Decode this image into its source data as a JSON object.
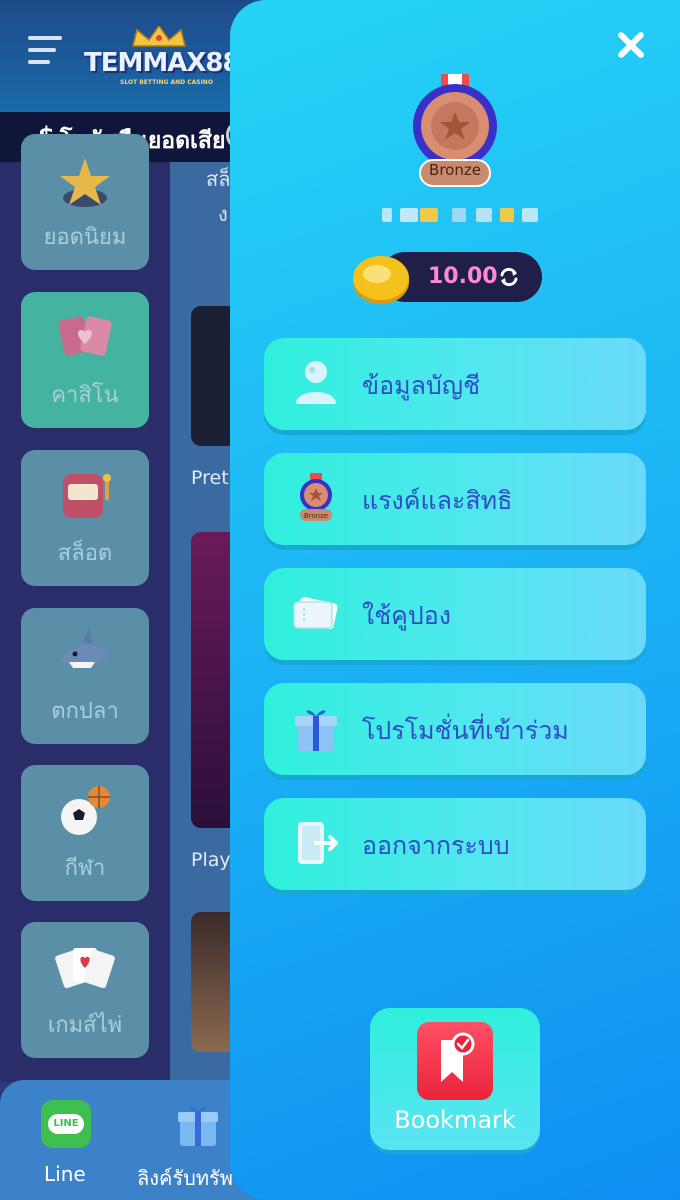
{
  "header": {
    "logo_text": "TEMMAX88",
    "logo_subtitle": "SLOT BETTING AND CASINO"
  },
  "ticker": {
    "currency_symbol": "$",
    "text": "โบนัสคืนยอดเสีย"
  },
  "sidebar": {
    "categories": [
      {
        "label": "ยอดนิยม",
        "icon": "star-chip-icon",
        "active": false
      },
      {
        "label": "คาสิโน",
        "icon": "cards-icon",
        "active": true
      },
      {
        "label": "สล็อต",
        "icon": "slot-machine-icon",
        "active": false
      },
      {
        "label": "ตกปลา",
        "icon": "shark-icon",
        "active": false
      },
      {
        "label": "กีฬา",
        "icon": "sports-ball-icon",
        "active": false
      },
      {
        "label": "เกมส์ไพ่",
        "icon": "playing-cards-icon",
        "active": false
      }
    ]
  },
  "content": {
    "heading_line1": "สล็",
    "heading_line2": "ง",
    "providers": [
      "Pret",
      "Play"
    ]
  },
  "bottom_nav": {
    "items": [
      {
        "label": "Line",
        "icon": "line-icon"
      },
      {
        "label": "ลิงค์รับทรัพ",
        "icon": "gift-icon"
      }
    ]
  },
  "drawer": {
    "rank": "Bronze",
    "balance": "10.00",
    "menu": [
      {
        "label": "ข้อมูลบัญชี",
        "icon": "user-icon"
      },
      {
        "label": "แรงค์และสิทธิ",
        "icon": "medal-icon"
      },
      {
        "label": "ใช้คูปอง",
        "icon": "coupon-icon"
      },
      {
        "label": "โปรโมชั่นที่เข้าร่วม",
        "icon": "gift-box-icon"
      },
      {
        "label": "ออกจากระบบ",
        "icon": "logout-icon"
      }
    ],
    "bookmark_label": "Bookmark"
  },
  "colors": {
    "drawer_top": "#25d3f5",
    "drawer_bottom": "#0f8ff2",
    "menu_button": "#2ff0dc",
    "menu_text": "#2f4cc8",
    "balance_text": "#ff88d8",
    "rank_badge": "#c98a6e"
  }
}
